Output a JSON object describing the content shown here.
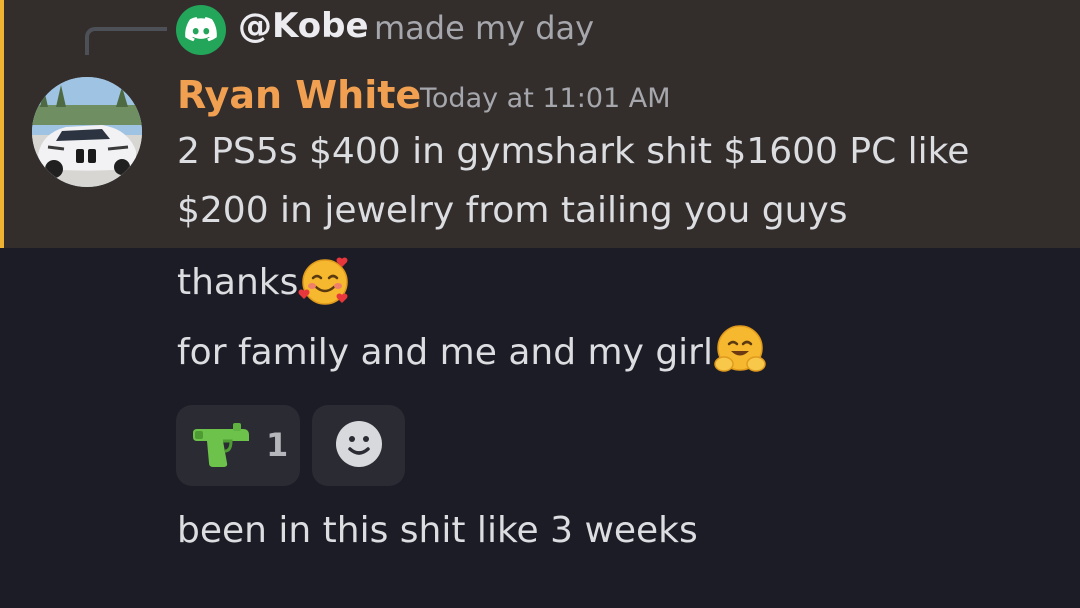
{
  "reply": {
    "icon": "discord-icon",
    "mention": "@Kobe",
    "text": "made my day"
  },
  "message": {
    "avatar": "car-avatar",
    "username": "Ryan White",
    "username_color": "#f0a050",
    "timestamp": "Today at 11:01 AM",
    "line1": "2 PS5s $400 in gymshark shit $1600 PC like",
    "line2": "$200 in jewelry from tailing you guys"
  },
  "followups": {
    "thanks": "thanks",
    "thanks_emoji": "smiling-face-with-hearts-emoji",
    "family": "for family and me and my girl",
    "family_emoji": "hugging-face-emoji",
    "weeks": "been in this shit like 3 weeks"
  },
  "reactions": [
    {
      "emoji": "water-pistol-emoji",
      "count": "1"
    }
  ],
  "add_reaction_icon": "add-reaction-smiley-icon",
  "colors": {
    "highlight_bg": "#332e2c",
    "highlight_bar": "#f0b232",
    "background": "#1c1c26",
    "discord_green": "#23a55a"
  }
}
